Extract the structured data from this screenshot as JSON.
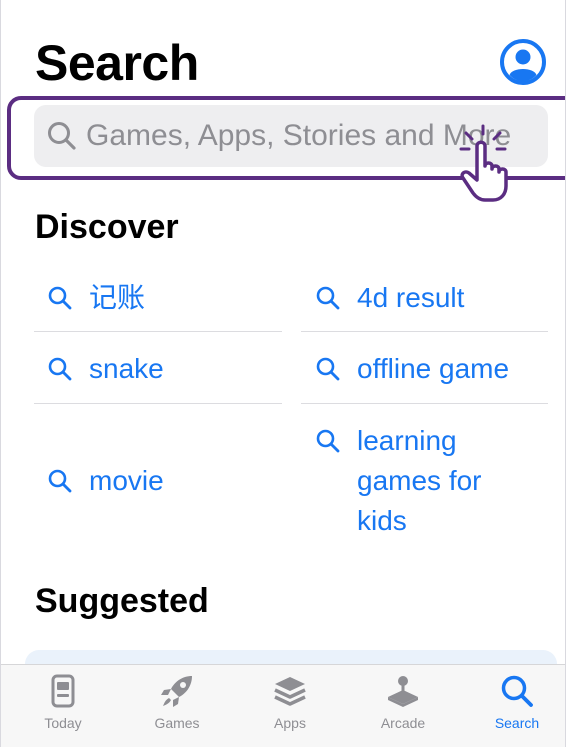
{
  "header": {
    "title": "Search"
  },
  "search": {
    "placeholder": "Games, Apps, Stories and More"
  },
  "discover": {
    "title": "Discover",
    "items": [
      {
        "label": "记账"
      },
      {
        "label": "4d result"
      },
      {
        "label": "snake"
      },
      {
        "label": "offline game"
      },
      {
        "label": "movie"
      },
      {
        "label": "learning games for kids"
      }
    ]
  },
  "suggested": {
    "title": "Suggested"
  },
  "tabbar": {
    "tabs": [
      {
        "label": "Today",
        "icon": "today-icon"
      },
      {
        "label": "Games",
        "icon": "rocket-icon"
      },
      {
        "label": "Apps",
        "icon": "layers-icon"
      },
      {
        "label": "Arcade",
        "icon": "joystick-icon"
      },
      {
        "label": "Search",
        "icon": "search-icon",
        "active": true
      }
    ]
  },
  "colors": {
    "accent": "#1877f2",
    "highlight": "#5b2d82",
    "inactive": "#8e8e93"
  }
}
